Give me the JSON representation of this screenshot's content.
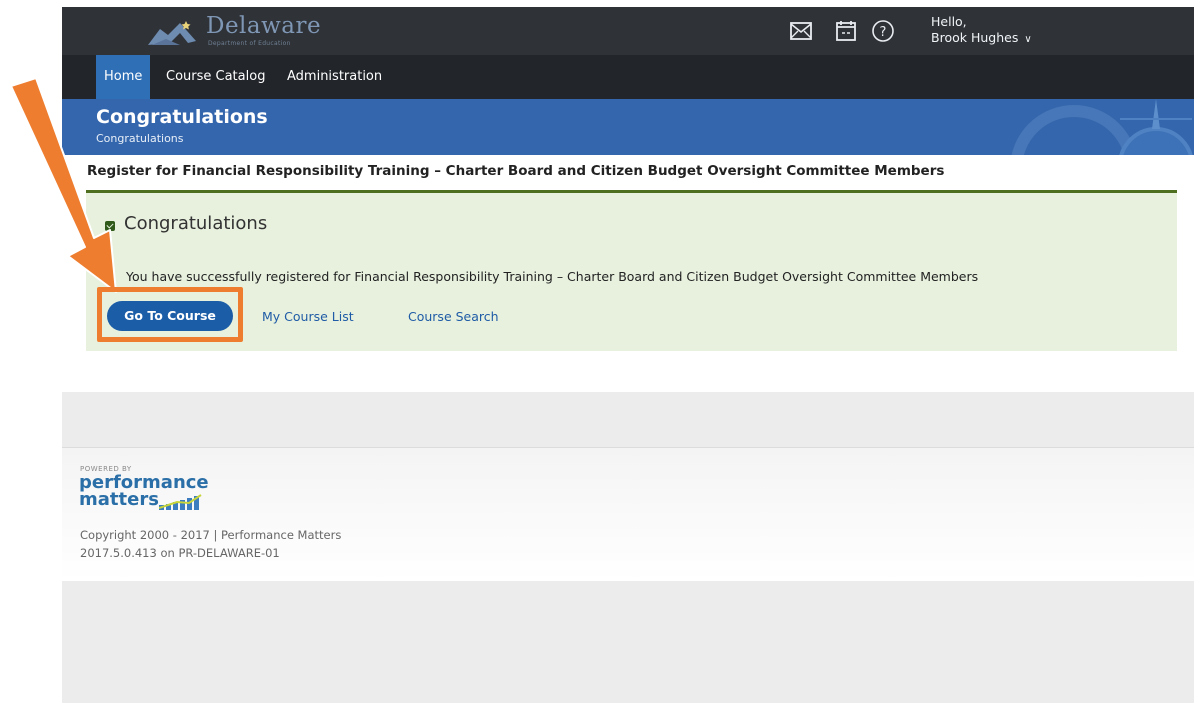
{
  "header": {
    "logo_word": "Delaware",
    "logo_sub": "Department of Education",
    "greeting": "Hello,",
    "user_name": "Brook Hughes",
    "icons": [
      "mail-icon",
      "calendar-icon",
      "help-icon"
    ]
  },
  "nav": {
    "items": [
      {
        "label": "Home",
        "active": true
      },
      {
        "label": "Course Catalog",
        "active": false
      },
      {
        "label": "Administration",
        "active": false
      }
    ]
  },
  "banner": {
    "title": "Congratulations",
    "subtitle": "Congratulations"
  },
  "register": {
    "title": "Register for Financial Responsibility Training – Charter Board and Citizen Budget Oversight Committee Members"
  },
  "success": {
    "heading": "Congratulations",
    "message": "You have successfully registered for Financial Responsibility Training – Charter Board and Citizen Budget Oversight Committee Members",
    "go_button": "Go To Course",
    "my_course_list": "My Course List",
    "course_search": "Course Search"
  },
  "footer": {
    "powered_by": "POWERED BY",
    "brand_line1": "performance",
    "brand_line2": "matters",
    "copyright": "Copyright 2000 - 2017 | Performance Matters",
    "version": "2017.5.0.413 on PR-DELAWARE-01"
  },
  "colors": {
    "topbar": "#2f3338",
    "navbar": "#22262b",
    "nav_active": "#2f6fb6",
    "banner": "#3466ad",
    "success_bg": "#e7f1de",
    "success_rule": "#4d6f1f",
    "primary_button": "#1c5da8",
    "annotation": "#ee7d2f"
  }
}
